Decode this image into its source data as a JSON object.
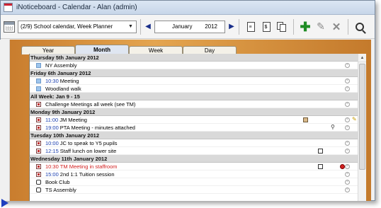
{
  "window": {
    "title": "iNoticeboard - Calendar - Alan (admin)"
  },
  "toolbar": {
    "calendar_select_value": "(2/9) School calendar, Week Planner",
    "month": "January",
    "year": "2012"
  },
  "tabs": [
    {
      "label": "Year",
      "active": false
    },
    {
      "label": "Month",
      "active": true
    },
    {
      "label": "Week",
      "active": false
    },
    {
      "label": "Day",
      "active": false
    }
  ],
  "rows": [
    {
      "type": "header",
      "text": "Thursday 5th January 2012"
    },
    {
      "type": "event",
      "icon": "blue-square-icon",
      "time": "",
      "title": "NY Assembly",
      "markers": []
    },
    {
      "type": "header",
      "text": "Friday 6th January 2012"
    },
    {
      "type": "event",
      "icon": "blue-square-icon",
      "time": "10:30",
      "title": "Meeting",
      "markers": []
    },
    {
      "type": "event",
      "icon": "blue-square-icon",
      "time": "",
      "title": "Woodland walk",
      "markers": []
    },
    {
      "type": "header",
      "text": "All Week: Jan 9 - 15"
    },
    {
      "type": "event",
      "icon": "document-icon",
      "time": "",
      "title": "Challenge Meetings all week (see TM)",
      "markers": []
    },
    {
      "type": "header",
      "text": "Monday 9th January 2012"
    },
    {
      "type": "event",
      "icon": "document-icon",
      "time": "11:00",
      "title": "JM Meeting",
      "markers": [
        "note-icon",
        "pencil-icon"
      ]
    },
    {
      "type": "event",
      "icon": "document-icon",
      "time": "19:00",
      "title": "PTA Meeting - minutes attached",
      "markers": [
        "attachment-icon"
      ]
    },
    {
      "type": "header",
      "text": "Tuesday 10th January 2012"
    },
    {
      "type": "event",
      "icon": "document-icon",
      "time": "10:00",
      "title": "JC to speak to Y5 pupils",
      "markers": []
    },
    {
      "type": "event",
      "icon": "document-icon",
      "time": "12:15",
      "title": "Staff lunch on lower site",
      "markers": [
        "calendar-item-icon"
      ]
    },
    {
      "type": "header",
      "text": "Wednesday 11th January 2012"
    },
    {
      "type": "event",
      "icon": "document-icon",
      "time": "10:30",
      "title": "TM Meeting in staffroom",
      "red": true,
      "markers": [
        "calendar-item-icon",
        "red-dot-icon"
      ]
    },
    {
      "type": "event",
      "icon": "document-icon",
      "time": "15:00",
      "title": "2nd 1:1 Tuition session",
      "markers": []
    },
    {
      "type": "event",
      "icon": "recurring-icon",
      "time": "",
      "title": "Book Club",
      "markers": []
    },
    {
      "type": "event",
      "icon": "recurring-icon",
      "time": "",
      "title": "TS Assembly",
      "markers": []
    }
  ]
}
